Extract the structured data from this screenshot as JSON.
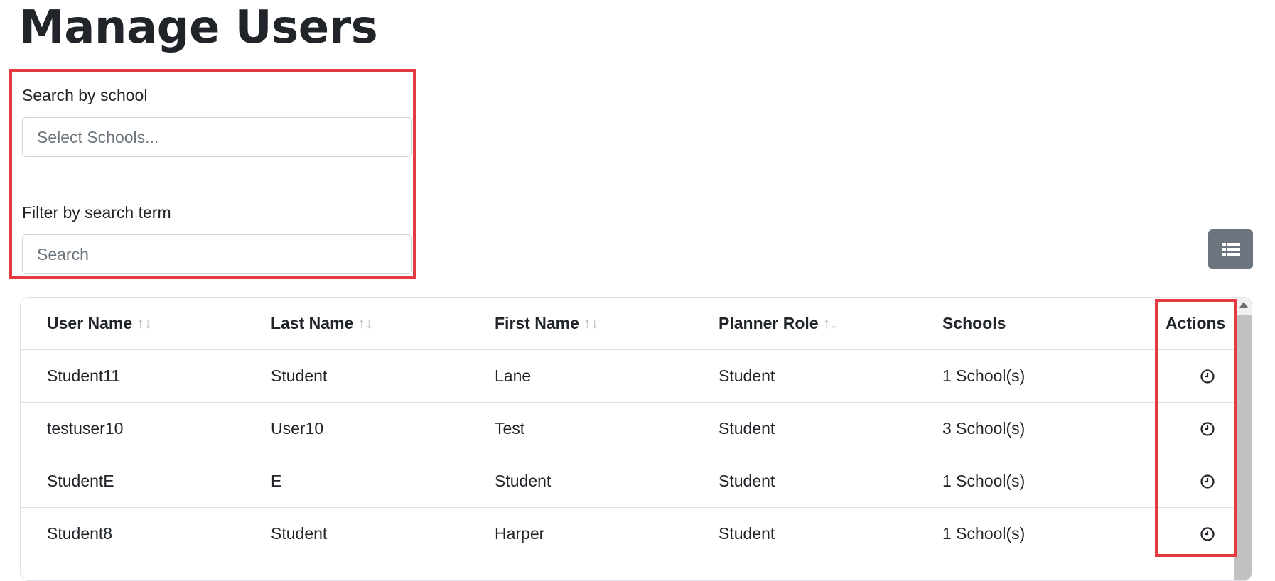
{
  "page": {
    "title": "Manage Users"
  },
  "filters": {
    "school": {
      "label": "Search by school",
      "placeholder": "Select Schools..."
    },
    "term": {
      "label": "Filter by search term",
      "placeholder": "Search"
    }
  },
  "toolbar": {
    "columns_icon": "list-icon"
  },
  "table": {
    "columns": [
      {
        "label": "User Name",
        "sortable": true
      },
      {
        "label": "Last Name",
        "sortable": true
      },
      {
        "label": "First Name",
        "sortable": true
      },
      {
        "label": "Planner Role",
        "sortable": true
      },
      {
        "label": "Schools",
        "sortable": false
      },
      {
        "label": "Actions",
        "sortable": false
      }
    ],
    "sort_glyph": "↑↓",
    "rows": [
      {
        "user_name": "Student11",
        "last_name": "Student",
        "first_name": "Lane",
        "role": "Student",
        "schools": "1 School(s)",
        "action_icon": "clock-icon"
      },
      {
        "user_name": "testuser10",
        "last_name": "User10",
        "first_name": "Test",
        "role": "Student",
        "schools": "3 School(s)",
        "action_icon": "clock-icon"
      },
      {
        "user_name": "StudentE",
        "last_name": "E",
        "first_name": "Student",
        "role": "Student",
        "schools": "1 School(s)",
        "action_icon": "clock-icon"
      },
      {
        "user_name": "Student8",
        "last_name": "Student",
        "first_name": "Harper",
        "role": "Student",
        "schools": "1 School(s)",
        "action_icon": "clock-icon"
      }
    ]
  },
  "colors": {
    "highlight": "#e53a40",
    "button_bg": "#6c757d",
    "text": "#212529",
    "border": "#dee2e6"
  }
}
